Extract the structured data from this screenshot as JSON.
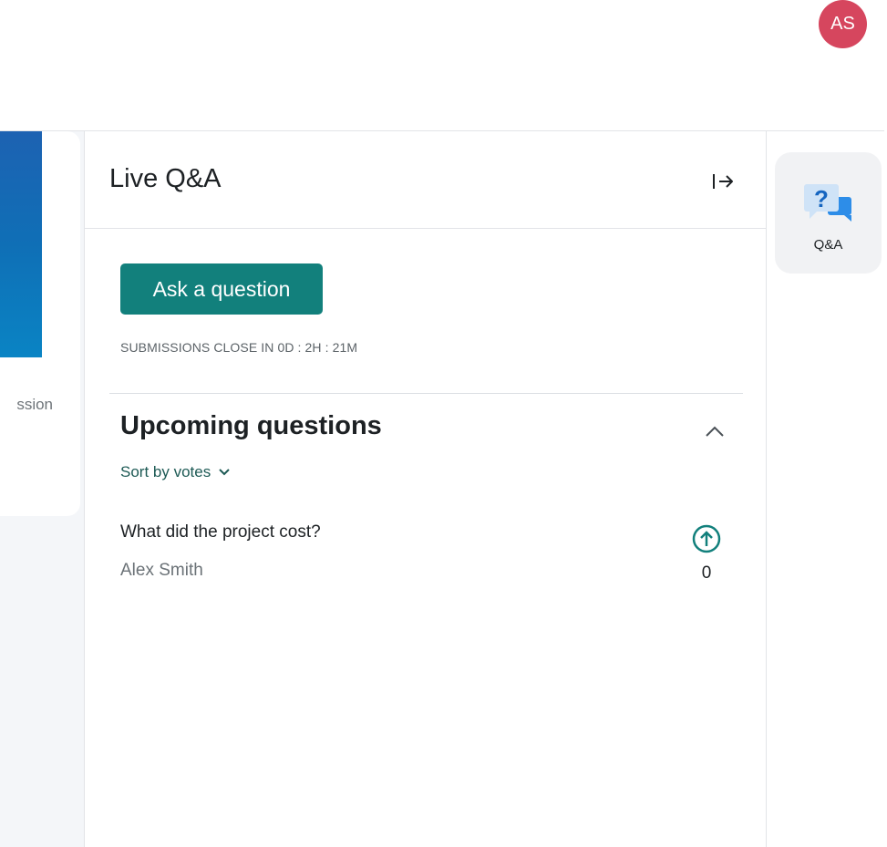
{
  "user": {
    "initials": "AS"
  },
  "left_card": {
    "partial_text": "ssion"
  },
  "qa_panel": {
    "title": "Live Q&A",
    "ask_button_label": "Ask a question",
    "submissions_text": "SUBMISSIONS CLOSE IN 0D : 2H : 21M",
    "upcoming_title": "Upcoming questions",
    "sort_label": "Sort by votes",
    "questions": [
      {
        "text": "What did the project cost?",
        "author": "Alex Smith",
        "votes": "0"
      }
    ]
  },
  "sidebar_tab": {
    "label": "Q&A",
    "icon": "qa-speech-bubbles-icon"
  },
  "colors": {
    "accent": "#12807c",
    "avatar": "#d6465e",
    "tab_icon_blue": "#2d8de8"
  }
}
